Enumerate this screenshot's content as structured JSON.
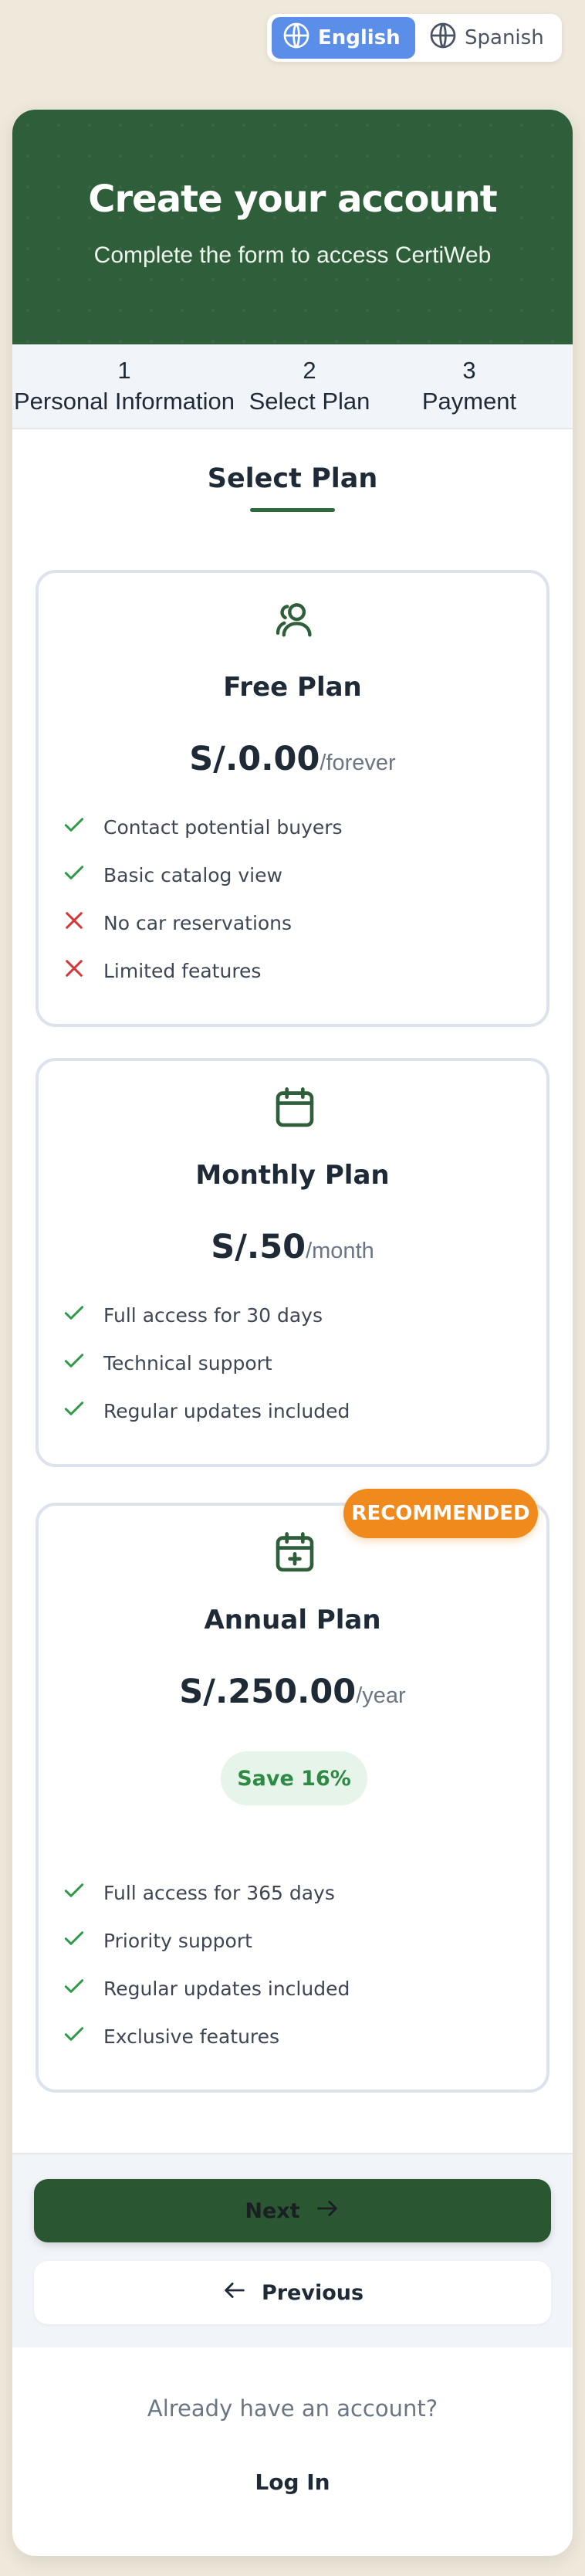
{
  "language_switcher": {
    "options": [
      {
        "label": "English",
        "icon": "globe-icon",
        "active": true
      },
      {
        "label": "Spanish",
        "icon": "globe-icon",
        "active": false
      }
    ],
    "active_color": "#5b8ee8"
  },
  "header": {
    "title": "Create your account",
    "subtitle": "Complete the form to access CertiWeb",
    "background_color": "#2f5e3a"
  },
  "steps": [
    {
      "number": "1",
      "label": "Personal Information"
    },
    {
      "number": "2",
      "label": "Select Plan"
    },
    {
      "number": "3",
      "label": "Payment"
    }
  ],
  "section_title": "Select Plan",
  "plans": [
    {
      "icon": "users-icon",
      "name": "Free Plan",
      "price": "S/.0.00",
      "period": "/forever",
      "features": [
        {
          "text": "Contact potential buyers",
          "included": true
        },
        {
          "text": "Basic catalog view",
          "included": true
        },
        {
          "text": "No car reservations",
          "included": false
        },
        {
          "text": "Limited features",
          "included": false
        }
      ]
    },
    {
      "icon": "calendar-icon",
      "name": "Monthly Plan",
      "price": "S/.50",
      "period": "/month",
      "features": [
        {
          "text": "Full access for 30 days",
          "included": true
        },
        {
          "text": "Technical support",
          "included": true
        },
        {
          "text": "Regular updates included",
          "included": true
        }
      ]
    },
    {
      "icon": "calendar-plus-icon",
      "name": "Annual Plan",
      "price": "S/.250.00",
      "period": "/year",
      "badge": "RECOMMENDED",
      "savings": "Save 16%",
      "features": [
        {
          "text": "Full access for 365 days",
          "included": true
        },
        {
          "text": "Priority support",
          "included": true
        },
        {
          "text": "Regular updates included",
          "included": true
        },
        {
          "text": "Exclusive features",
          "included": true
        }
      ]
    }
  ],
  "buttons": {
    "next": "Next",
    "next_icon": "arrow-right-icon",
    "previous": "Previous",
    "previous_icon": "arrow-left-icon"
  },
  "footer": {
    "question": "Already have an account?",
    "login": "Log In"
  },
  "colors": {
    "check": "#2e9a4a",
    "cross": "#d93535",
    "badge": "#f08a1c",
    "primary_button": "#2a5632"
  }
}
